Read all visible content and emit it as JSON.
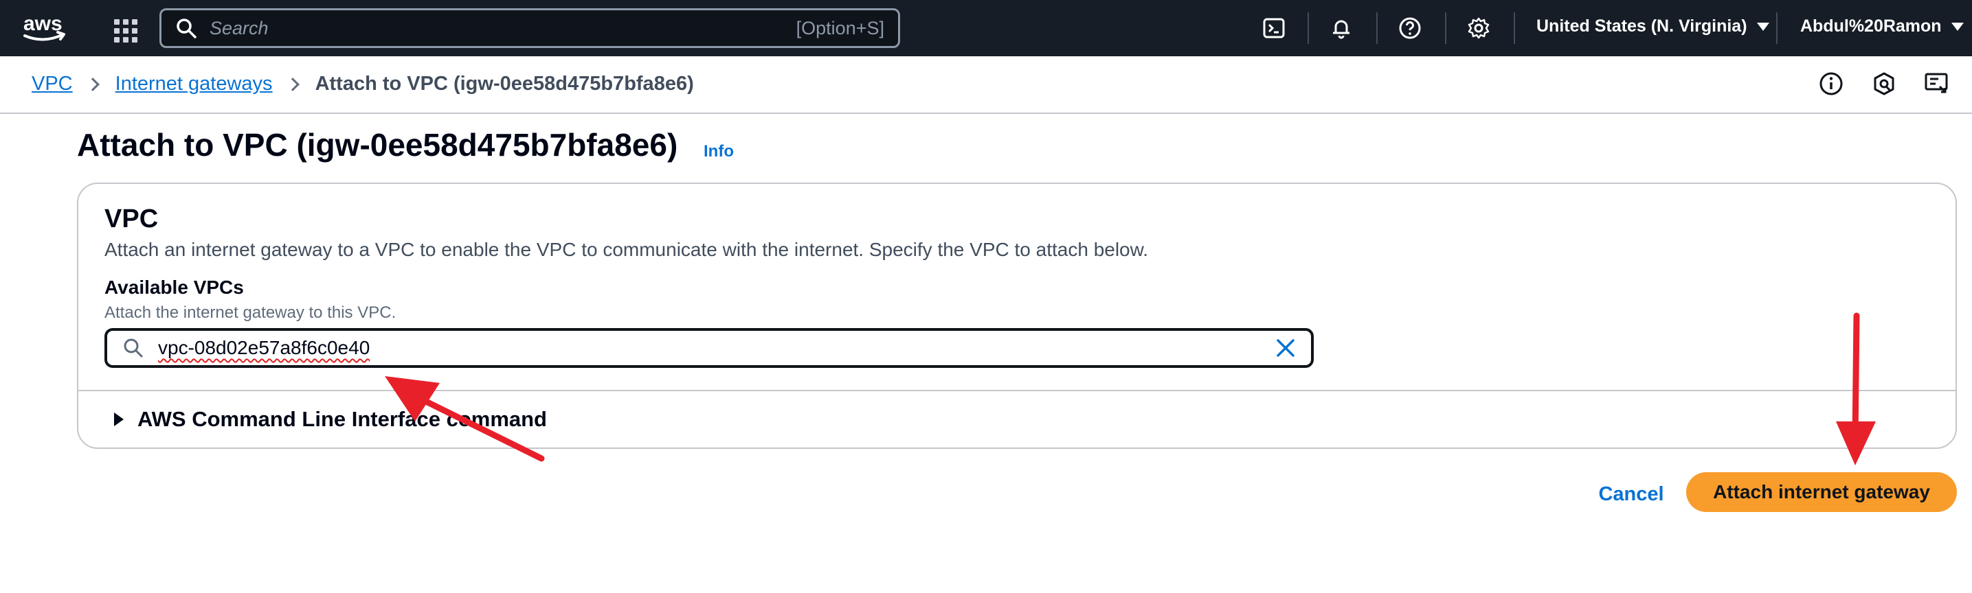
{
  "topnav": {
    "logo_text": "aws",
    "search_placeholder": "Search",
    "search_shortcut": "[Option+S]",
    "icons": [
      "apps-grid-icon",
      "cloudshell-icon",
      "bell-icon",
      "help-icon",
      "gear-icon"
    ],
    "region": "United States (N. Virginia)",
    "user": "Abdul%20Ramon"
  },
  "breadcrumb": {
    "items": [
      "VPC",
      "Internet gateways"
    ],
    "current": "Attach to VPC (igw-0ee58d475b7bfa8e6)"
  },
  "tools": {
    "icons": [
      "info-icon",
      "security-icon",
      "feedback-icon"
    ]
  },
  "page": {
    "title": "Attach to VPC (igw-0ee58d475b7bfa8e6)",
    "info_link": "Info"
  },
  "panel": {
    "title": "VPC",
    "description": "Attach an internet gateway to a VPC to enable the VPC to communicate with the internet. Specify the VPC to attach below.",
    "field_label": "Available VPCs",
    "field_description": "Attach the internet gateway to this VPC.",
    "field_value": "vpc-08d02e57a8f6c0e40",
    "expander_label": "AWS Command Line Interface command"
  },
  "actions": {
    "cancel": "Cancel",
    "submit": "Attach internet gateway"
  },
  "colors": {
    "nav_bg": "#161d26",
    "link": "#0972d3",
    "primary_button": "#f89c2c",
    "annotation_arrow": "#e8202a"
  }
}
